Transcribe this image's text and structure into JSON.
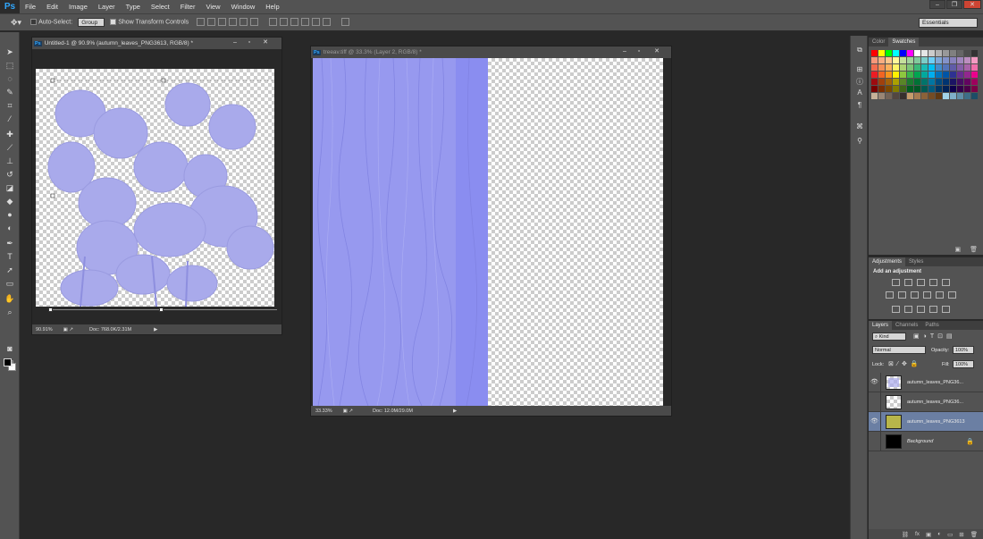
{
  "app": {
    "logo": "Ps"
  },
  "menu": [
    "File",
    "Edit",
    "Image",
    "Layer",
    "Type",
    "Select",
    "Filter",
    "View",
    "Window",
    "Help"
  ],
  "options": {
    "auto_select_label": "Auto-Select:",
    "auto_select_value": "Group",
    "transform_label": "Show Transform Controls",
    "workspace": "Essentials"
  },
  "doc1": {
    "title": "Untitled-1 @ 90.9% (autumn_leaves_PNG3613, RGB/8) *",
    "zoom": "90.91%",
    "doc_size": "Doc: 768.0K/2.31M"
  },
  "doc2": {
    "title": "treeav.tiff @ 33.3% (Layer 2, RGB/8) *",
    "zoom": "33.33%",
    "doc_size": "Doc: 12.0M/29.0M"
  },
  "panels": {
    "color_tabs": [
      "Color",
      "Swatches"
    ],
    "adj_tabs": [
      "Adjustments",
      "Styles"
    ],
    "adj_title": "Add an adjustment",
    "layer_tabs": [
      "Layers",
      "Channels",
      "Paths"
    ],
    "kind": "Kind",
    "blend_mode": "Normal",
    "opacity_label": "Opacity:",
    "opacity_value": "100%",
    "lock_label": "Lock:",
    "fill_label": "Fill:",
    "fill_value": "100%"
  },
  "layers": [
    {
      "name": "autumn_leaves_PNG36...",
      "visible": true,
      "selected": false
    },
    {
      "name": "autumn_leaves_PNG36...",
      "visible": false,
      "selected": false
    },
    {
      "name": "autumn_leaves_PNG3613",
      "visible": true,
      "selected": true
    },
    {
      "name": "Background",
      "visible": false,
      "selected": false
    }
  ],
  "colors": {
    "leaf": "#a9aaeb",
    "bark": "#8f93f0",
    "accent": "#31a8ff",
    "selected_layer": "#6b7fa3"
  }
}
